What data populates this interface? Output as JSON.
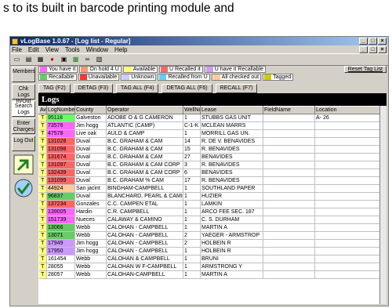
{
  "caption": "s to its built in barcode printing module and",
  "window": {
    "title": "vLogBase 1.0.67 - [Log list - Regular]"
  },
  "menu": [
    "File",
    "Edit",
    "View",
    "Tools",
    "Window",
    "Help"
  ],
  "sidebar": [
    {
      "label": "Members"
    },
    {
      "label": "Chk Logs In/Out"
    },
    {
      "label": "Search Logs"
    },
    {
      "label": "Enter Charges"
    },
    {
      "label": "Log Out"
    }
  ],
  "legend": {
    "items": [
      {
        "label": "You have it",
        "color": "#ff66ff"
      },
      {
        "label": "On hold 4 U",
        "color": "#ff9966"
      },
      {
        "label": "Available",
        "color": "#ffff66"
      },
      {
        "label": "U Recalled it",
        "color": "#ff6666"
      },
      {
        "label": "U have it Recallable",
        "color": "#cc99ff"
      },
      {
        "label": "Recallable",
        "color": "#66cc66"
      },
      {
        "label": "Unavailable",
        "color": "#ff3333"
      },
      {
        "label": "Unknown",
        "color": "#ccccff"
      },
      {
        "label": "Recalled from U",
        "color": "#66ccff"
      },
      {
        "label": "All checked out",
        "color": "#ffcc99"
      },
      {
        "label": "Tagged",
        "color": "#cccc00"
      }
    ],
    "reset": "Reset Tag List"
  },
  "tagbar": [
    "TAG (F2)",
    "DETAG (F3)",
    "TAG ALL (F4)",
    "DETAG ALL (F6)",
    "RECALL (F7)"
  ],
  "logs_title": "Logs",
  "columns": [
    "Ava",
    "LogNumber",
    "County",
    "Operator",
    "WellNo",
    "Lease",
    "FieldName",
    "Location"
  ],
  "rows": [
    [
      "T",
      "95118",
      "Galveston",
      "ADOBE O & G CAMERON",
      "1",
      "STUBBS GAS UNIT",
      "",
      "A- 26"
    ],
    [
      "T",
      "73576",
      "Jim hogg",
      "ATLANTIC (CAMP)",
      "C-1-K",
      "MCLEAN MARRS",
      "",
      ""
    ],
    [
      "T",
      "47578",
      "Live oak",
      "AULD & CAMP",
      "1",
      "MORRILL GAS UN.",
      "",
      ""
    ],
    [
      "T",
      "131028",
      "Duval",
      "B.C. GRAHAM & CAM",
      "14",
      "R. DE V. BENAVIDES",
      "",
      ""
    ],
    [
      "T",
      "131098",
      "Duval",
      "B.C. GRAHAM & CAM",
      "15",
      "R. BENAVIDES",
      "",
      ""
    ],
    [
      "T",
      "131674",
      "Duval",
      "B.C. GRAHAM & CAM",
      "27",
      "BENAVIDES",
      "",
      ""
    ],
    [
      "T",
      "131097",
      "Duval",
      "B.C. GRAHAM & CAM CORP",
      "3",
      "R. BENAVIDES",
      "",
      ""
    ],
    [
      "T",
      "132439",
      "Duval",
      "B.C. GRAHAM & CAM CORP",
      "6",
      "BENAVIDES",
      "",
      ""
    ],
    [
      "T",
      "131099",
      "Duval",
      "B.C. GRAHAM % CAM",
      "17",
      "R. BENAVIDES",
      "",
      ""
    ],
    [
      "T",
      "44924",
      "San jacint",
      "BINGHAM-CAMPBELL",
      "1",
      "SOUTHLAND PAPER",
      "",
      ""
    ],
    [
      "T",
      "96837",
      "Duval",
      "BLANCHARD, PEARL & CAMI",
      "1",
      "HUZIER",
      "",
      ""
    ],
    [
      "T",
      "137234",
      "Gonzales",
      "C.C. CAMPEN ETAL",
      "1",
      "LAMKIN",
      "",
      ""
    ],
    [
      "T",
      "139005",
      "Hardin",
      "C.R. CAMPBELL",
      "1",
      "ARCO FEE SEC. 187",
      "",
      ""
    ],
    [
      "T",
      "151739",
      "Nueces",
      "CALAWAY & CAMINO",
      "1",
      "C. S. DURHAM",
      "",
      ""
    ],
    [
      "T",
      "13066",
      "Webb",
      "CALOHAN - CAMPBELL",
      "1",
      "MARTIN A",
      "",
      ""
    ],
    [
      "T",
      "13071",
      "Webb",
      "CALOHAN - CAMPBELL",
      "2",
      "YAEGER - ARMSTROP",
      "",
      ""
    ],
    [
      "T",
      "17949",
      "Jim hogg",
      "CALOHAN - CAMPBELL",
      "2",
      "HOLBEIN R",
      "",
      ""
    ],
    [
      "T",
      "17950",
      "Jim hogg",
      "CALOHAN - CAMPBELL",
      "1",
      "HOLBEIN R",
      "",
      ""
    ],
    [
      "T",
      "161454",
      "Webb",
      "CALOHAN & CAMPBELL",
      "1",
      "BRUNI",
      "",
      ""
    ],
    [
      "T",
      "28055",
      "Webb",
      "CALOHAN W F-CAMPBELL",
      "1",
      "ARMSTRONG Y",
      "",
      ""
    ],
    [
      "T",
      "28057",
      "Webb",
      "CALOHAN-CAMPBELL",
      "1",
      "MARTIN A",
      "",
      ""
    ]
  ],
  "row_colors": [
    "#66ff66",
    "#ff66ff",
    "#ff66ff",
    "#ff6666",
    "#ff6666",
    "#ff6666",
    "#ff6666",
    "#ff6666",
    "#ff6666",
    "#ffcc99",
    "#66cc66",
    "#ff6666",
    "#ff66ff",
    "#ff66ff",
    "#66cc66",
    "#66cc66",
    "#cc99ff",
    "#cc99ff",
    "#ffffff",
    "#ffffff",
    "#ffffff"
  ]
}
